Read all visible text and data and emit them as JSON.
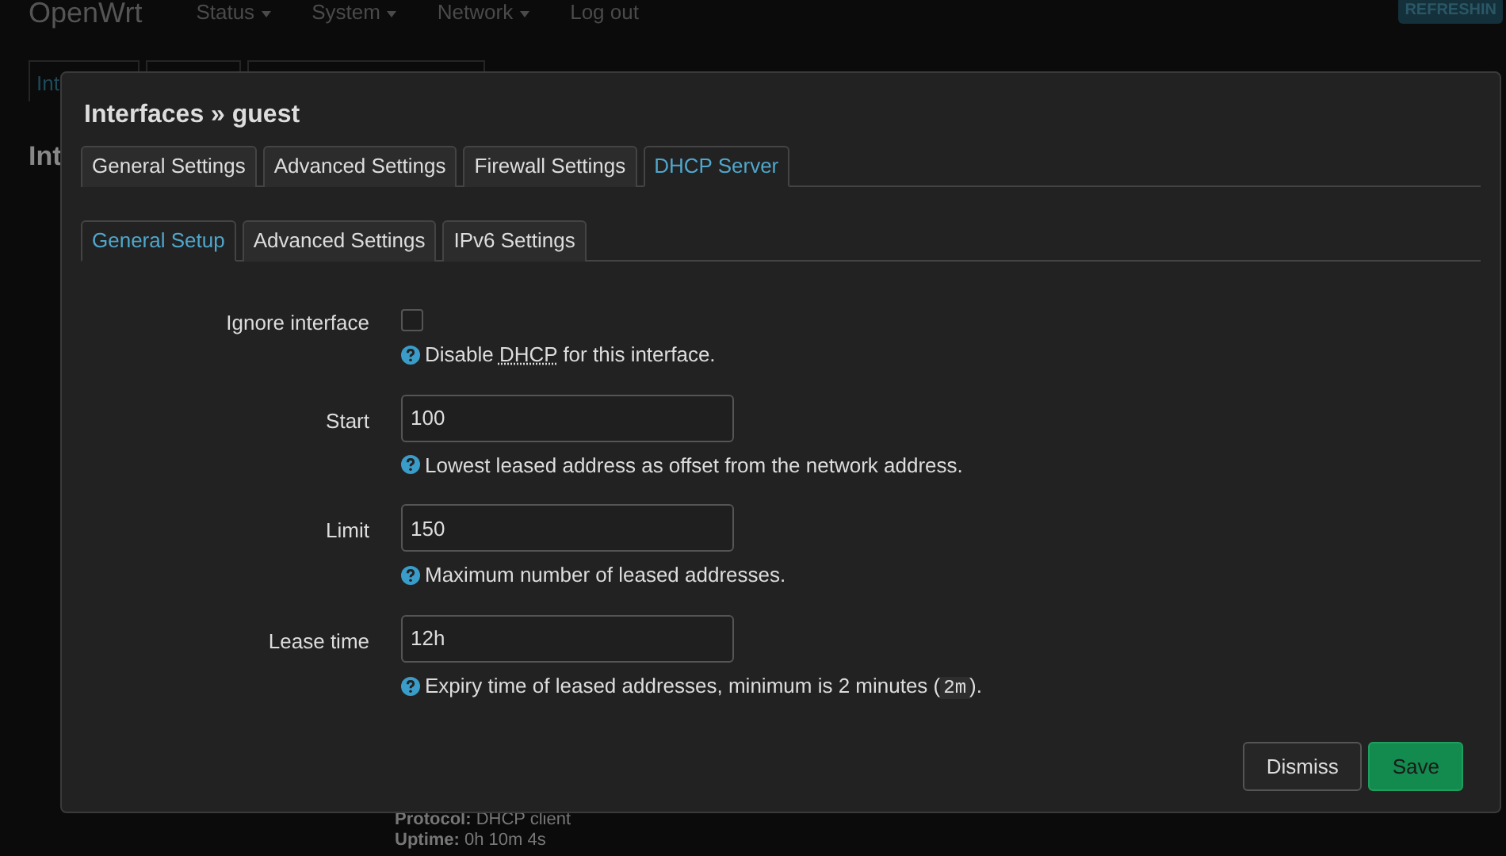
{
  "background": {
    "brand": "OpenWrt",
    "menu": [
      {
        "label": "Status",
        "dropdown": true
      },
      {
        "label": "System",
        "dropdown": true
      },
      {
        "label": "Network",
        "dropdown": true
      },
      {
        "label": "Log out",
        "dropdown": false
      }
    ],
    "badge": "REFRESHIN",
    "tab": "Int",
    "heading": "Int",
    "details": [
      {
        "label": "Protocol:",
        "value": "DHCP client"
      },
      {
        "label": "Uptime:",
        "value": "0h 10m 4s"
      }
    ]
  },
  "dialog": {
    "title": "Interfaces » guest",
    "tabs": [
      {
        "label": "General Settings",
        "selected": false
      },
      {
        "label": "Advanced Settings",
        "selected": false
      },
      {
        "label": "Firewall Settings",
        "selected": false
      },
      {
        "label": "DHCP Server",
        "selected": true
      }
    ],
    "subtabs": [
      {
        "label": "General Setup",
        "selected": true
      },
      {
        "label": "Advanced Settings",
        "selected": false
      },
      {
        "label": "IPv6 Settings",
        "selected": false
      }
    ],
    "fields": [
      {
        "kind": "checkbox",
        "label": "Ignore interface",
        "checked": false,
        "help": [
          {
            "text": "Disable "
          },
          {
            "text": "DHCP",
            "kind": "abbr"
          },
          {
            "text": " for this interface."
          }
        ]
      },
      {
        "kind": "text",
        "label": "Start",
        "value": "100",
        "help": [
          {
            "text": "Lowest leased address as offset from the network address."
          }
        ]
      },
      {
        "kind": "text",
        "label": "Limit",
        "value": "150",
        "help": [
          {
            "text": "Maximum number of leased addresses."
          }
        ]
      },
      {
        "kind": "text",
        "label": "Lease time",
        "value": "12h",
        "help": [
          {
            "text": "Expiry time of leased addresses, minimum is 2 minutes ("
          },
          {
            "text": "2m",
            "kind": "code"
          },
          {
            "text": ")."
          }
        ]
      }
    ],
    "buttons": [
      {
        "label": "Dismiss",
        "kind": "secondary"
      },
      {
        "label": "Save",
        "kind": "primary"
      }
    ]
  }
}
